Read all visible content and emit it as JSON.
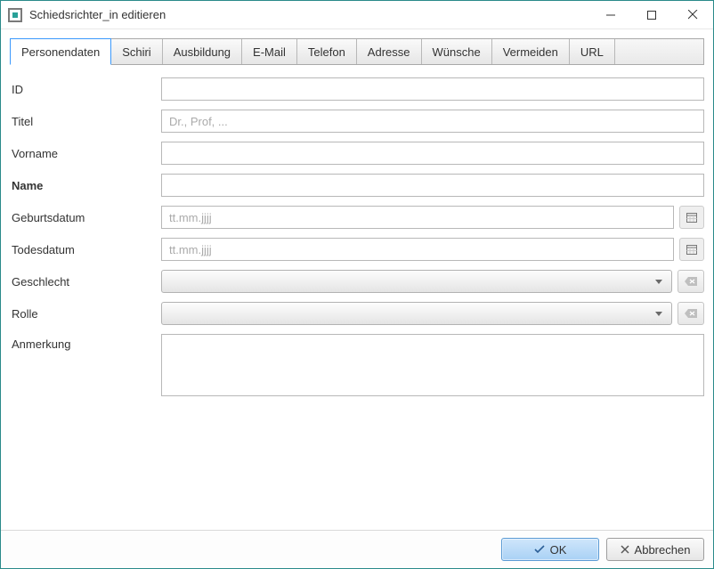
{
  "window": {
    "title": "Schiedsrichter_in editieren"
  },
  "tabs": [
    {
      "label": "Personendaten",
      "active": true
    },
    {
      "label": "Schiri"
    },
    {
      "label": "Ausbildung"
    },
    {
      "label": "E-Mail"
    },
    {
      "label": "Telefon"
    },
    {
      "label": "Adresse"
    },
    {
      "label": "Wünsche"
    },
    {
      "label": "Vermeiden"
    },
    {
      "label": "URL"
    }
  ],
  "fields": {
    "id": {
      "label": "ID",
      "value": "",
      "placeholder": ""
    },
    "titel": {
      "label": "Titel",
      "value": "",
      "placeholder": "Dr., Prof, ..."
    },
    "vorname": {
      "label": "Vorname",
      "value": "",
      "placeholder": ""
    },
    "name": {
      "label": "Name",
      "value": "",
      "placeholder": ""
    },
    "geburt": {
      "label": "Geburtsdatum",
      "value": "",
      "placeholder": "tt.mm.jjjj"
    },
    "tod": {
      "label": "Todesdatum",
      "value": "",
      "placeholder": "tt.mm.jjjj"
    },
    "geschlecht": {
      "label": "Geschlecht",
      "value": ""
    },
    "rolle": {
      "label": "Rolle",
      "value": ""
    },
    "anmerkung": {
      "label": "Anmerkung",
      "value": "",
      "placeholder": ""
    }
  },
  "buttons": {
    "ok": "OK",
    "cancel": "Abbrechen"
  }
}
